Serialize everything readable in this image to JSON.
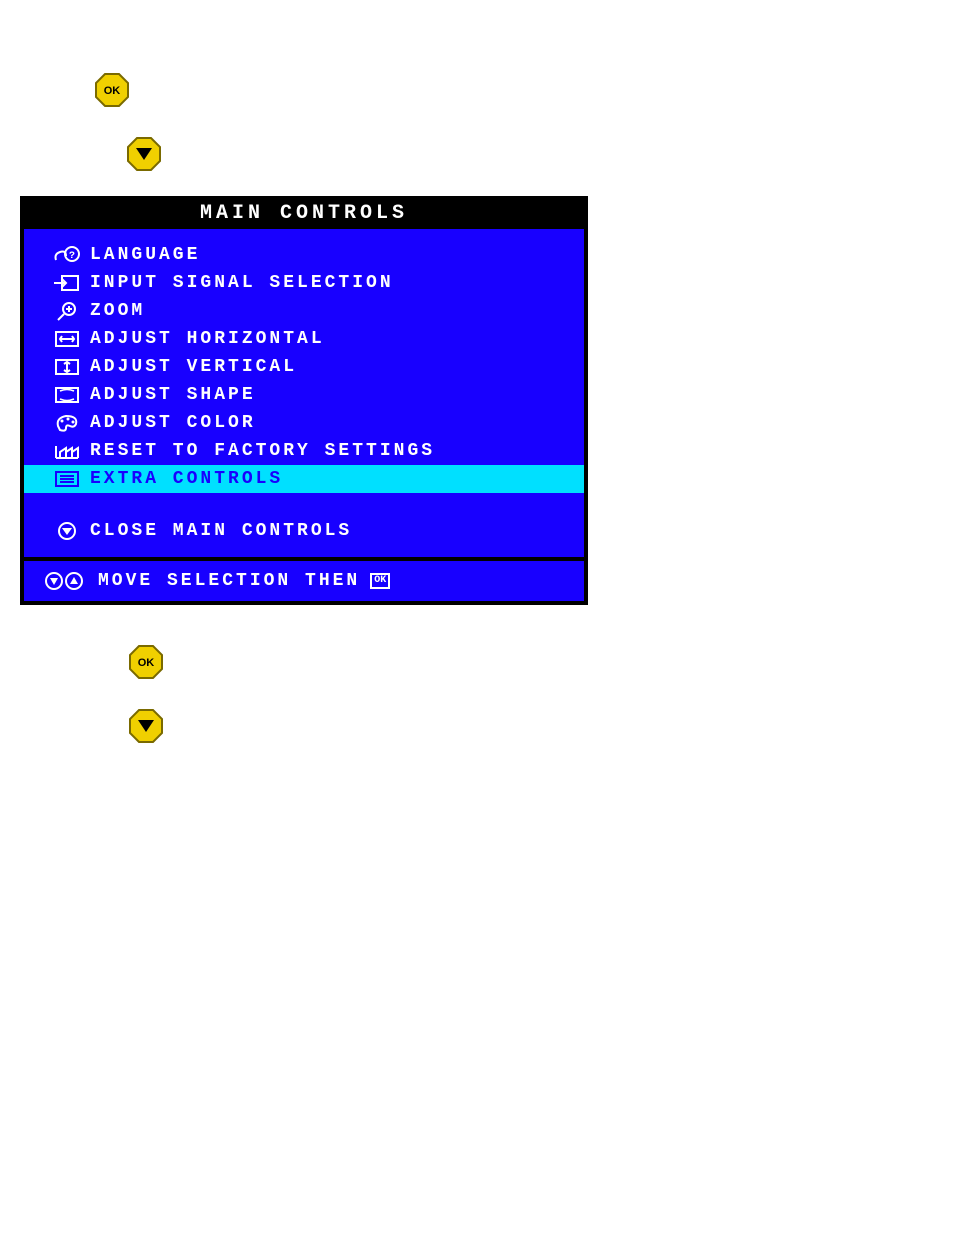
{
  "buttons": {
    "ok_label": "OK",
    "down_label": "▼"
  },
  "osd": {
    "title": "MAIN CONTROLS",
    "items": [
      {
        "label": "LANGUAGE",
        "highlighted": false
      },
      {
        "label": "INPUT SIGNAL SELECTION",
        "highlighted": false
      },
      {
        "label": "ZOOM",
        "highlighted": false
      },
      {
        "label": "ADJUST HORIZONTAL",
        "highlighted": false
      },
      {
        "label": "ADJUST VERTICAL",
        "highlighted": false
      },
      {
        "label": "ADJUST SHAPE",
        "highlighted": false
      },
      {
        "label": "ADJUST COLOR",
        "highlighted": false
      },
      {
        "label": "RESET TO FACTORY SETTINGS",
        "highlighted": false
      },
      {
        "label": "EXTRA CONTROLS",
        "highlighted": true
      }
    ],
    "close_label": "CLOSE MAIN CONTROLS",
    "footer_text": "MOVE SELECTION THEN",
    "footer_ok": "OK"
  }
}
